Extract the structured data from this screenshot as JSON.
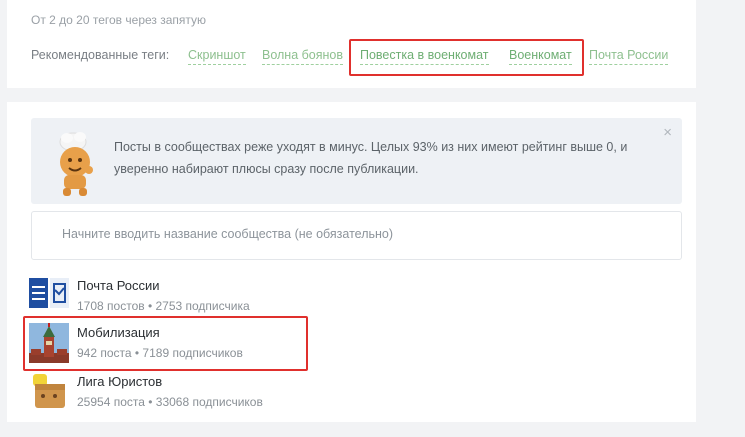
{
  "tags_section": {
    "hint": "От 2 до 20 тегов через запятую",
    "recommended_label": "Рекомендованные теги:",
    "tags": [
      "Скриншот",
      "Волна боянов",
      "Повестка в военкомат",
      "Военкомат",
      "Почта России"
    ],
    "highlighted_tags": [
      "Повестка в военкомат",
      "Военкомат"
    ]
  },
  "notice": {
    "text": "Посты в сообществах реже уходят в минус. Целых 93% из них имеют рейтинг выше 0, и уверенно набирают плюсы сразу после публикации.",
    "close_icon": "×"
  },
  "community_search": {
    "placeholder": "Начните вводить название сообщества (не обязательно)",
    "value": ""
  },
  "communities": [
    {
      "name": "Почта России",
      "stats": "1708 постов • 2753 подписчика",
      "avatar": "post-russia-logo"
    },
    {
      "name": "Мобилизация",
      "stats": "942 поста • 7189 подписчиков",
      "avatar": "kremlin-tower",
      "highlighted": true
    },
    {
      "name": "Лига Юристов",
      "stats": "25954 поста • 33068 подписчиков",
      "avatar": "lawyer-mascot"
    }
  ],
  "colors": {
    "tag_green": "#8ec08f",
    "highlight_red": "#e0302d",
    "notice_bg": "#eef1f5"
  }
}
